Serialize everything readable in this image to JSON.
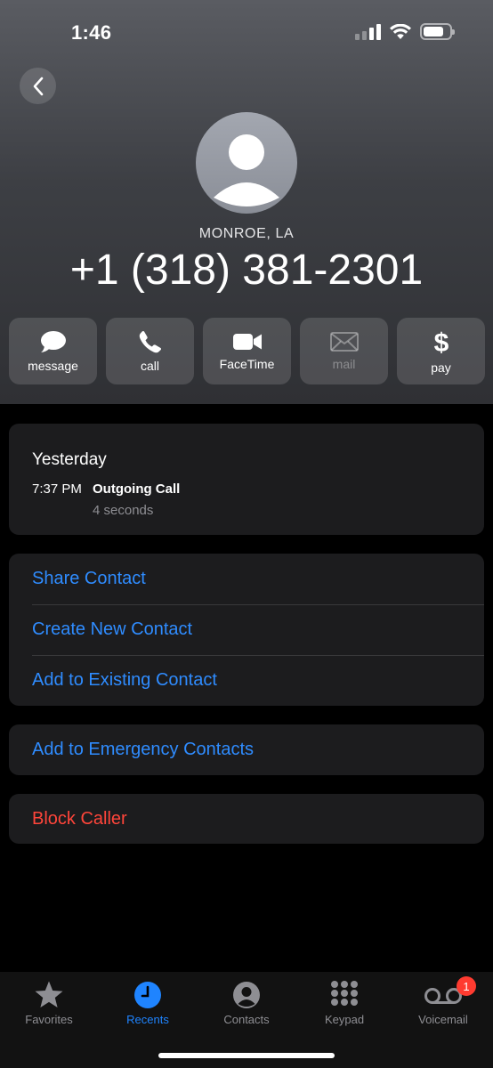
{
  "status_bar": {
    "time": "1:46"
  },
  "contact": {
    "location": "MONROE, LA",
    "phone": "+1 (318) 381-2301"
  },
  "actions": [
    {
      "label": "message",
      "icon": "message-icon",
      "enabled": true
    },
    {
      "label": "call",
      "icon": "phone-icon",
      "enabled": true
    },
    {
      "label": "FaceTime",
      "icon": "video-icon",
      "enabled": true
    },
    {
      "label": "mail",
      "icon": "mail-icon",
      "enabled": false
    },
    {
      "label": "pay",
      "icon": "dollar-icon",
      "enabled": true
    }
  ],
  "history": {
    "day": "Yesterday",
    "time": "7:37 PM",
    "type": "Outgoing Call",
    "duration": "4 seconds"
  },
  "options": {
    "share": "Share Contact",
    "create": "Create New Contact",
    "add_existing": "Add to Existing Contact",
    "emergency": "Add to Emergency Contacts",
    "block": "Block Caller"
  },
  "tabs": {
    "favorites": "Favorites",
    "recents": "Recents",
    "contacts": "Contacts",
    "keypad": "Keypad",
    "voicemail": "Voicemail",
    "voicemail_badge": "1"
  },
  "colors": {
    "accent": "#2f8cff",
    "destructive": "#ff453a",
    "tab_active": "#1f84ff",
    "card": "#1c1c1e"
  }
}
